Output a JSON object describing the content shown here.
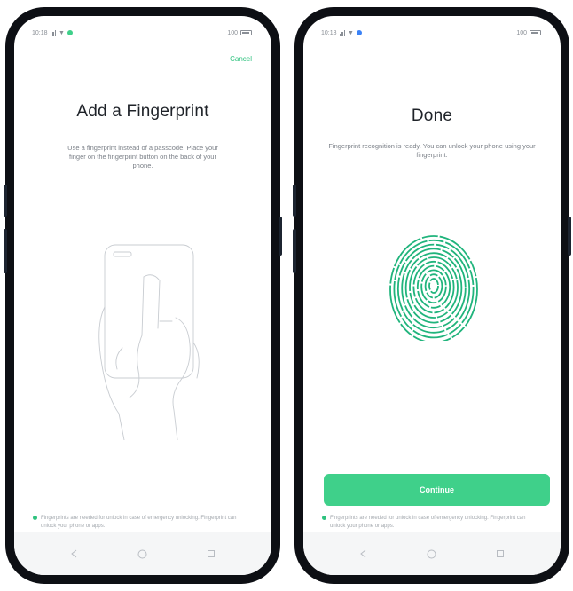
{
  "left_screen": {
    "status_bar": {
      "time": "10:18",
      "battery": "100"
    },
    "cancel_label": "Cancel",
    "title": "Add a Fingerprint",
    "description": "Use a fingerprint instead of a passcode. Place your finger on the fingerprint button on the back of your phone.",
    "note": "Fingerprints are needed for unlock in case of emergency unlocking. Fingerprint can unlock your phone or apps."
  },
  "right_screen": {
    "status_bar": {
      "time": "10:18",
      "battery": "100"
    },
    "title": "Done",
    "description": "Fingerprint recognition is ready. You can unlock your phone using your fingerprint.",
    "continue_label": "Continue",
    "note": "Fingerprints are needed for unlock in case of emergency unlocking. Fingerprint can unlock your phone or apps."
  },
  "nav_icons": [
    "back-icon",
    "home-icon",
    "recents-icon"
  ],
  "colors": {
    "accent": "#2ec27e",
    "button": "#3fd08a",
    "fingerprint": "#20b47c",
    "phone_frame": "#0d0f14"
  }
}
